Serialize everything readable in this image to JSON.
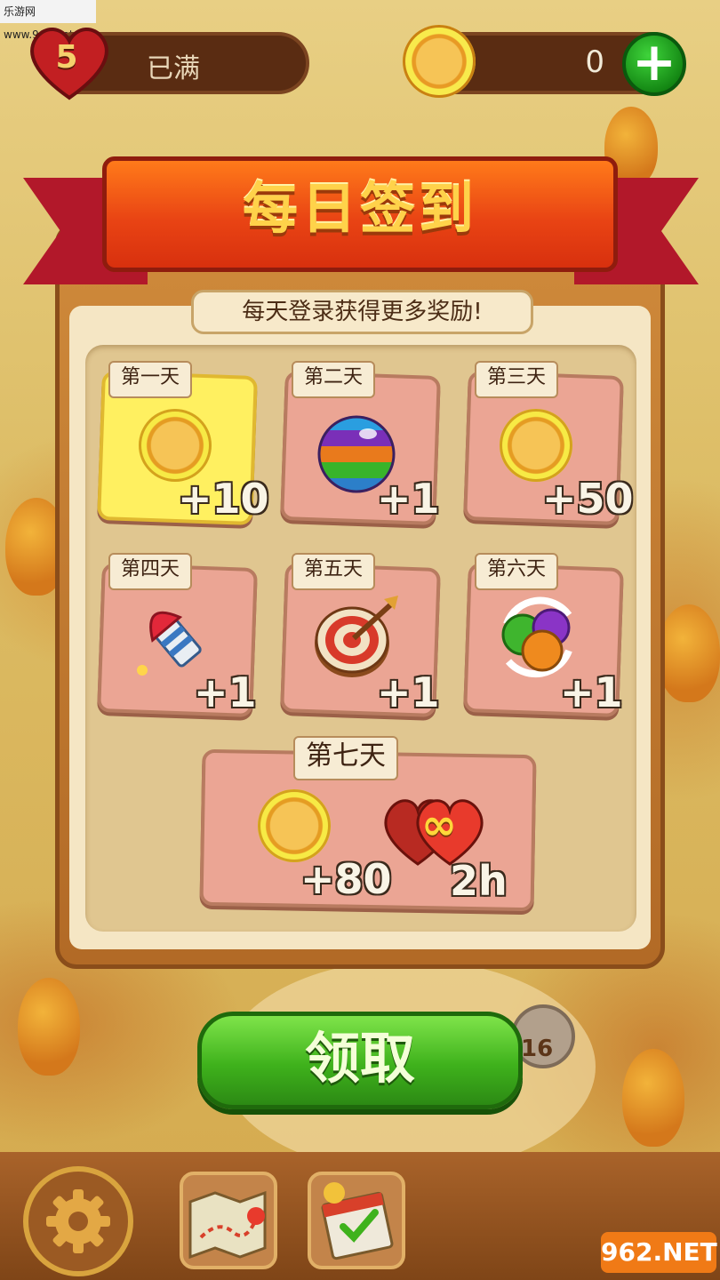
{
  "watermark": "乐游网 www.962.net",
  "status": {
    "lives": "5",
    "lives_status": "已满",
    "coins": "0"
  },
  "panel": {
    "title": "每日签到",
    "subtitle": "每天登录获得更多奖励!",
    "rewards": [
      {
        "day": "第一天",
        "amount": "+10",
        "icon": "gold-coin-icon",
        "claimed_today": true
      },
      {
        "day": "第二天",
        "amount": "+1",
        "icon": "rainbow-ball-icon"
      },
      {
        "day": "第三天",
        "amount": "+50",
        "icon": "gold-coin-icon"
      },
      {
        "day": "第四天",
        "amount": "+1",
        "icon": "rocket-booster-icon"
      },
      {
        "day": "第五天",
        "amount": "+1",
        "icon": "target-dart-icon"
      },
      {
        "day": "第六天",
        "amount": "+1",
        "icon": "shuffle-balls-icon"
      }
    ],
    "day7": {
      "day": "第七天",
      "coins": "+80",
      "lives": "2h",
      "lives_symbol": "∞"
    }
  },
  "claim_button": "领取",
  "map": {
    "level_number": "16"
  },
  "logo": "962.NET"
}
